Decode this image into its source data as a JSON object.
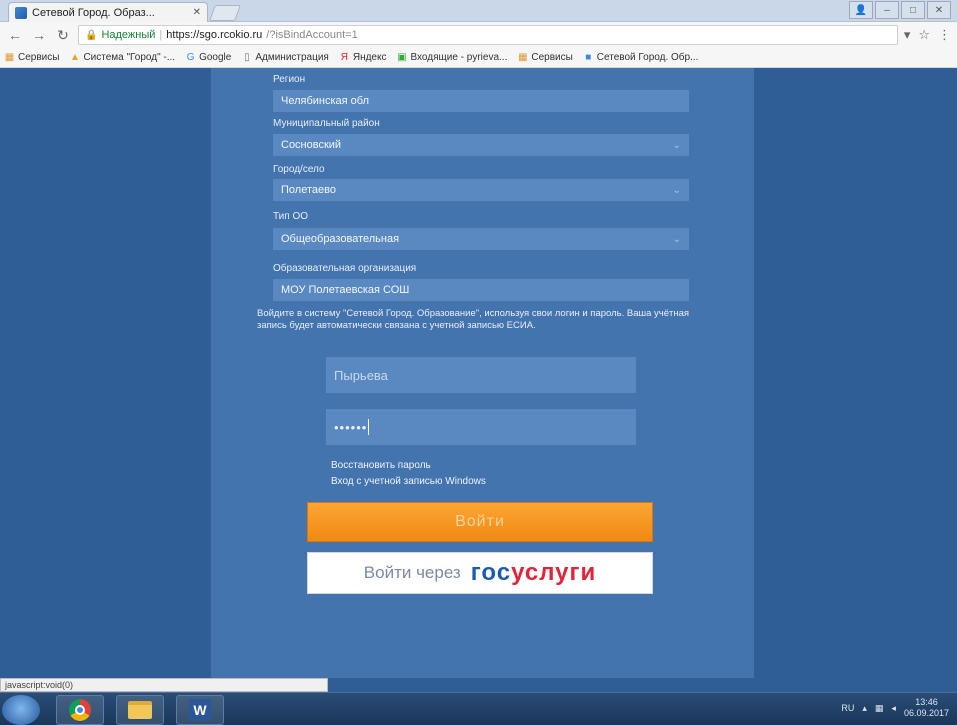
{
  "browser": {
    "tab_title": "Сетевой Город. Образ...",
    "tab_close": "✕",
    "secure_label": "Надежный",
    "url_host": "https://sgo.rcokio.ru",
    "url_path": "/?isBindAccount=1",
    "bookmarks": [
      {
        "icon": "apps-icon",
        "label": "Сервисы"
      },
      {
        "icon": "city-icon",
        "label": "Система \"Город\" -..."
      },
      {
        "icon": "google-icon",
        "label": "Google"
      },
      {
        "icon": "page-icon",
        "label": "Администрация"
      },
      {
        "icon": "yandex-icon",
        "label": "Яндекс"
      },
      {
        "icon": "mail-icon",
        "label": "Входящие - pyrieva..."
      },
      {
        "icon": "apps-icon",
        "label": "Сервисы"
      },
      {
        "icon": "city-icon",
        "label": "Сетевой Город. Обр..."
      }
    ],
    "status_text": "javascript:void(0)"
  },
  "form": {
    "region_label": "Регион",
    "region_value": "Челябинская обл",
    "district_label": "Муниципальный район",
    "district_value": "Сосновский",
    "city_label": "Город/село",
    "city_value": "Полетаево",
    "type_label": "Тип ОО",
    "type_value": "Общеобразовательная",
    "org_label": "Образовательная организация",
    "org_value": "МОУ Полетаевская СОШ",
    "notice": "Войдите в систему \"Сетевой Город. Образование\", используя свои логин и пароль. Ваша учётная запись будет автоматически связана с учетной записью ЕСИА.",
    "login_value": "Пырьева",
    "password_value": "••••••",
    "restore_link": "Восстановить пароль",
    "windows_link": "Вход с учетной записью Windows",
    "login_button": "Войти",
    "gos_prefix": "Войти через",
    "gos_brand_a": "гос",
    "gos_brand_b": "услуги"
  },
  "taskbar": {
    "lang": "RU",
    "time": "13:46",
    "date": "06.09.2017"
  }
}
